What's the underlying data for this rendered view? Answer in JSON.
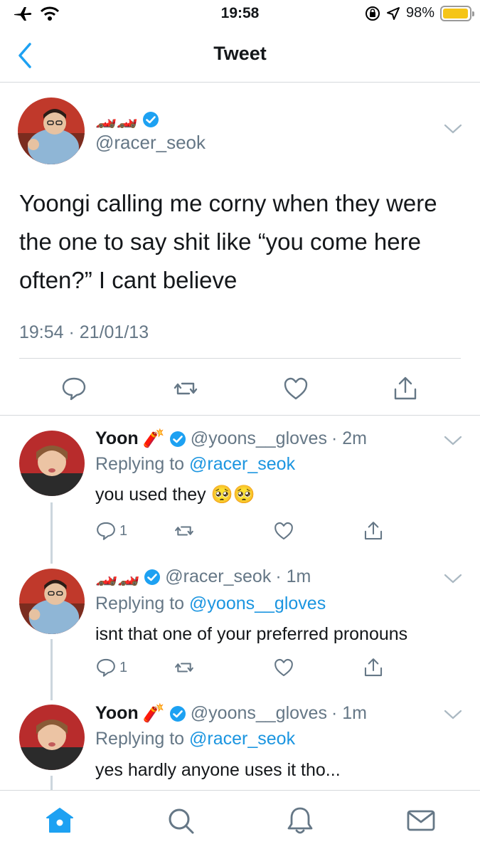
{
  "status_bar": {
    "time": "19:58",
    "battery": "98%",
    "battery_level": 0.98
  },
  "nav": {
    "title": "Tweet"
  },
  "main_tweet": {
    "emoji_name": "🏎️🏎️",
    "handle": "@racer_seok",
    "text": "Yoongi calling me corny when they were the one to say shit like “you come here often?” I cant believe",
    "timestamp": "19:54 · 21/01/13"
  },
  "replies": [
    {
      "name": "Yoon",
      "name_emoji": "🧨",
      "handle": "@yoons__gloves",
      "time": "· 2m",
      "replying_prefix": "Replying to",
      "replying_to": "@racer_seok",
      "text": "you used they 🥺🥺",
      "reply_count": "1"
    },
    {
      "name": "🏎️🏎️",
      "name_emoji": "",
      "handle": "@racer_seok",
      "time": "· 1m",
      "replying_prefix": "Replying to",
      "replying_to": "@yoons__gloves",
      "text": "isnt that one of your preferred pronouns",
      "reply_count": "1"
    },
    {
      "name": "Yoon",
      "name_emoji": "🧨",
      "handle": "@yoons__gloves",
      "time": "· 1m",
      "replying_prefix": "Replying to",
      "replying_to": "@racer_seok",
      "text": "yes hardly anyone uses it tho...",
      "reply_count": ""
    }
  ],
  "colors": {
    "accent": "#1da1f2",
    "secondary_text": "#657786",
    "verified": "#1da1f2"
  }
}
